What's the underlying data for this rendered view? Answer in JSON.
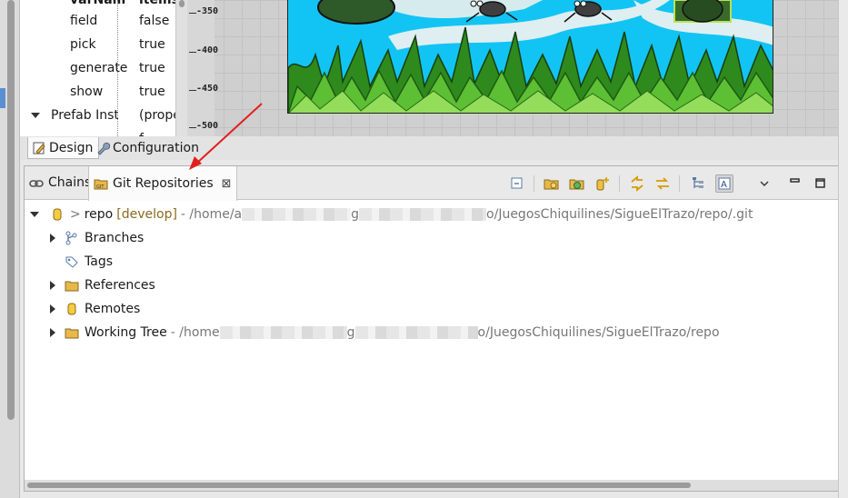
{
  "properties": {
    "rows": [
      {
        "key": "varNam",
        "value": "items"
      },
      {
        "key": "field",
        "value": "false"
      },
      {
        "key": "pick",
        "value": "true"
      },
      {
        "key": "generate",
        "value": "true"
      },
      {
        "key": "show",
        "value": "true"
      },
      {
        "key": "Prefab Instan",
        "value": "(prope"
      },
      {
        "key": "",
        "value": "f"
      }
    ]
  },
  "ruler": {
    "ticks": [
      "-350",
      "-400",
      "-450",
      "-500"
    ]
  },
  "design_tabs": {
    "design_label": "Design",
    "configuration_label": "Configuration"
  },
  "view": {
    "tabs": {
      "chains_label": "Chains",
      "git_label": "Git Repositories"
    },
    "tree": {
      "repo": {
        "prefix": ">",
        "name": "repo",
        "branch": "[develop]",
        "path_start": "- /home/a",
        "path_mid": "g",
        "path_end": "o/JuegosChiquilines/SigueElTrazo/repo/.git"
      },
      "branches_label": "Branches",
      "tags_label": "Tags",
      "references_label": "References",
      "remotes_label": "Remotes",
      "working_tree": {
        "name": "Working Tree",
        "path_start": "- /home",
        "path_mid": "g",
        "path_end": "o/JuegosChiquilines/SigueElTrazo/repo"
      }
    }
  },
  "colors": {
    "scene_sky": "#12c4f4",
    "annotation_arrow": "#e02020",
    "branch_text": "#8a6a1c"
  }
}
